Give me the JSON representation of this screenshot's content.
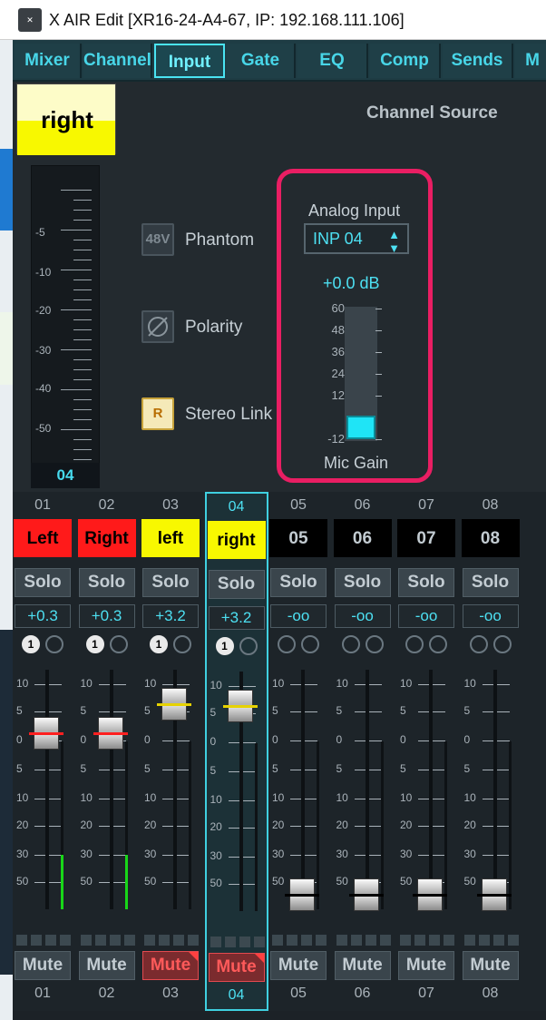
{
  "window": {
    "title": "X AIR Edit [XR16-24-A4-67, IP: 192.168.111.106]",
    "icon": "xair-logo-icon"
  },
  "nav": {
    "tabs": [
      "Mixer",
      "Channel",
      "Input",
      "Gate",
      "EQ",
      "Comp",
      "Sends",
      "M"
    ],
    "active": "Input"
  },
  "panel": {
    "channel_name": "right",
    "channel_number": "04",
    "section_title": "Channel Source",
    "meter_scale": [
      "-5",
      "-10",
      "-20",
      "-30",
      "-40",
      "-50"
    ],
    "phantom": {
      "button": "48V",
      "label": "Phantom"
    },
    "polarity": {
      "label": "Polarity",
      "icon": "polarity-icon"
    },
    "stereo_link": {
      "button": "R",
      "label": "Stereo Link"
    },
    "source": {
      "label": "Analog Input",
      "value": "INP 04"
    },
    "gain": {
      "value": "+0.0 dB",
      "label": "Mic Gain",
      "scale": [
        "60",
        "48",
        "36",
        "24",
        "12",
        "-12"
      ]
    }
  },
  "fader_scale": [
    "10",
    "5",
    "0",
    "5",
    "10",
    "20",
    "30",
    "50"
  ],
  "channels": [
    {
      "num": "01",
      "name": "Left",
      "name_bg": "#ff1a1a",
      "name_color": "#000000",
      "solo": "Solo",
      "value": "+0.3",
      "mute": "Mute",
      "badge": "1",
      "fader_pos": 0.74,
      "marker": "#ff2020",
      "meter": 0.3,
      "muted": false
    },
    {
      "num": "02",
      "name": "Right",
      "name_bg": "#ff1a1a",
      "name_color": "#000000",
      "solo": "Solo",
      "value": "+0.3",
      "mute": "Mute",
      "badge": "1",
      "fader_pos": 0.74,
      "marker": "#ff2020",
      "meter": 0.3,
      "muted": false
    },
    {
      "num": "03",
      "name": "left",
      "name_bg": "#f8f800",
      "name_color": "#000000",
      "solo": "Solo",
      "value": "+3.2",
      "mute": "Mute",
      "badge": "1",
      "fader_pos": 0.86,
      "marker": "#e6d200",
      "meter": 0,
      "muted": true
    },
    {
      "num": "04",
      "name": "right",
      "name_bg": "#f8f800",
      "name_color": "#000000",
      "solo": "Solo",
      "value": "+3.2",
      "mute": "Mute",
      "badge": "1",
      "fader_pos": 0.86,
      "marker": "#e6d200",
      "meter": 0,
      "muted": true
    },
    {
      "num": "05",
      "name": "05",
      "name_bg": "#000000",
      "name_color": "#c3ccd2",
      "solo": "Solo",
      "value": "-oo",
      "mute": "Mute",
      "badge": "",
      "fader_pos": 0.08,
      "marker": "#000000",
      "meter": 0,
      "muted": false
    },
    {
      "num": "06",
      "name": "06",
      "name_bg": "#000000",
      "name_color": "#c3ccd2",
      "solo": "Solo",
      "value": "-oo",
      "mute": "Mute",
      "badge": "",
      "fader_pos": 0.08,
      "marker": "#000000",
      "meter": 0,
      "muted": false
    },
    {
      "num": "07",
      "name": "07",
      "name_bg": "#000000",
      "name_color": "#c3ccd2",
      "solo": "Solo",
      "value": "-oo",
      "mute": "Mute",
      "badge": "",
      "fader_pos": 0.08,
      "marker": "#000000",
      "meter": 0,
      "muted": false
    },
    {
      "num": "08",
      "name": "08",
      "name_bg": "#000000",
      "name_color": "#c3ccd2",
      "solo": "Solo",
      "value": "-oo",
      "mute": "Mute",
      "badge": "",
      "fader_pos": 0.08,
      "marker": "#000000",
      "meter": 0,
      "muted": false
    }
  ],
  "selected_channel": "04"
}
